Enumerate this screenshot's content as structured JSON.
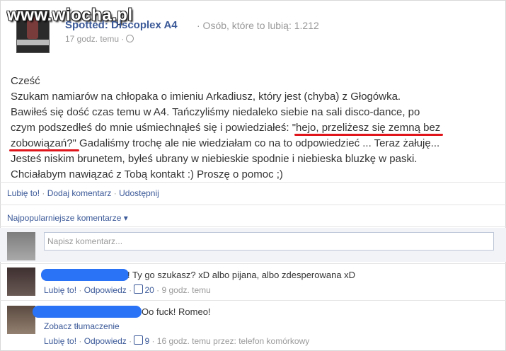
{
  "watermark": "www.wiocha.pl",
  "page": {
    "name": "Spotted: Discoplex A4",
    "likes_text": "· Osób, które to lubią: 1.212",
    "time": "17 godz. temu ·"
  },
  "post": {
    "lines": [
      "Cześć",
      "Szukam namiarów na chłopaka o imieniu Arkadiusz, który jest (chyba) z Głogówka.",
      "Bawiłeś się dość czas temu w A4. Tańczyliśmy niedaleko siebie na sali disco-dance, po",
      "czym podszedłeś do mnie uśmiechnąłeś się i powiedziałeś: \"",
      "hejo, przeliżesz się zemną bez",
      "zobowiązań?\"",
      " Gadaliśmy trochę ale nie wiedziałam co na to odpowiedzieć ... Teraz żałuję...",
      "Jesteś niskim brunetem, byłeś ubrany w niebieskie spodnie i niebieska bluzkę w paski.",
      "Chciałabym nawiązać z Tobą kontakt :) Proszę o pomoc ;)"
    ]
  },
  "actions": {
    "like": "Lubię to!",
    "comment": "Dodaj komentarz",
    "share": "Udostępnij"
  },
  "comments_sort": "Najpopularniejsze komentarze ▾",
  "comment_input": {
    "placeholder": "Napisz komentarz..."
  },
  "comments": [
    {
      "text": "! Ty go szukasz? xD albo pijana, albo zdesperowana xD",
      "like": "Lubię to!",
      "reply": "Odpowiedz",
      "likes": "20",
      "time": "· 9 godz. temu"
    },
    {
      "text": "Oo fuck! Romeo!",
      "translate": "Zobacz tłumaczenie",
      "like": "Lubię to!",
      "reply": "Odpowiedz",
      "likes": "9",
      "time": "· 16 godz. temu przez: telefon komórkowy"
    }
  ],
  "colors": {
    "link": "#3b5998",
    "underline": "#e0151b",
    "redaction": "#2a72f6"
  }
}
